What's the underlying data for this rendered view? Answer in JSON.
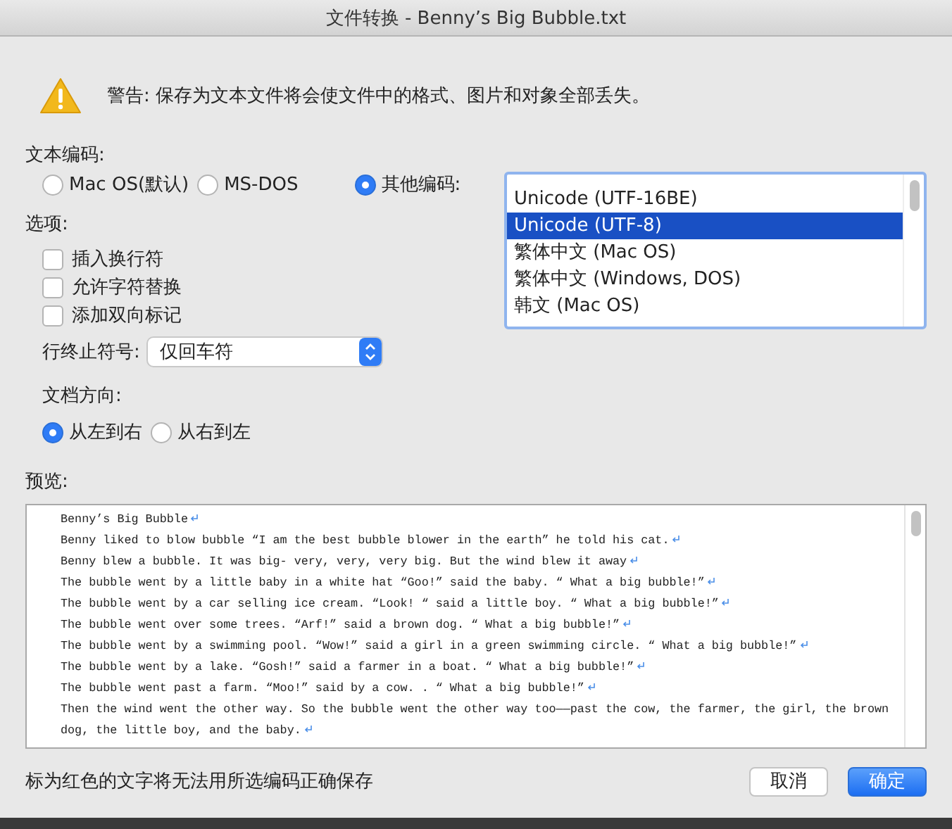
{
  "window": {
    "title": "文件转换 - Benny’s Big Bubble.txt"
  },
  "warning": {
    "text": "警告: 保存为文本文件将会使文件中的格式、图片和对象全部丢失。"
  },
  "encoding": {
    "label": "文本编码:",
    "options": [
      {
        "label": "Mac OS(默认)",
        "selected": false
      },
      {
        "label": "MS-DOS",
        "selected": false
      },
      {
        "label": "其他编码:",
        "selected": true
      }
    ],
    "list": [
      {
        "label": "Unicode (UTF-16BE)",
        "selected": false
      },
      {
        "label": "Unicode (UTF-8)",
        "selected": true
      },
      {
        "label": "繁体中文 (Mac OS)",
        "selected": false
      },
      {
        "label": "繁体中文 (Windows, DOS)",
        "selected": false
      },
      {
        "label": "韩文 (Mac OS)",
        "selected": false
      }
    ]
  },
  "options": {
    "label": "选项:",
    "checkboxes": [
      {
        "label": "插入换行符",
        "checked": false
      },
      {
        "label": "允许字符替换",
        "checked": false
      },
      {
        "label": "添加双向标记",
        "checked": false
      }
    ],
    "line_ending": {
      "label": "行终止符号:",
      "value": "仅回车符"
    }
  },
  "direction": {
    "label": "文档方向:",
    "options": [
      {
        "label": "从左到右",
        "selected": true
      },
      {
        "label": "从右到左",
        "selected": false
      }
    ]
  },
  "preview": {
    "label": "预览:",
    "paragraphs": [
      "Benny’s Big Bubble",
      "Benny liked to blow bubble “I am the best bubble blower in the earth” he told his cat.",
      "Benny blew a bubble. It was big- very, very, very big. But the wind blew it away",
      "The bubble went by a little baby in a white hat “Goo!” said the baby. “ What a big bubble!”",
      "The bubble went by a car selling ice cream. “Look! “ said a little boy. “ What a big bubble!”",
      "The bubble went over some trees. “Arf!” said a brown dog. “ What a big bubble!”",
      "The bubble went by a swimming pool. “Wow!” said a girl in a green swimming circle. “ What a big bubble!”",
      "The bubble went by a lake. “Gosh!” said a farmer in a boat. “ What a big bubble!”",
      "The bubble went past a farm. “Moo!” said by a cow. . “ What a big bubble!”",
      "Then the wind went the other way. So the bubble went the other way too——past the cow, the farmer, the girl, the brown dog, the little boy, and the baby."
    ]
  },
  "note": "标为红色的文字将无法用所选编码正确保存",
  "buttons": [
    {
      "label": "取消",
      "primary": false
    },
    {
      "label": "确定",
      "primary": true
    }
  ]
}
